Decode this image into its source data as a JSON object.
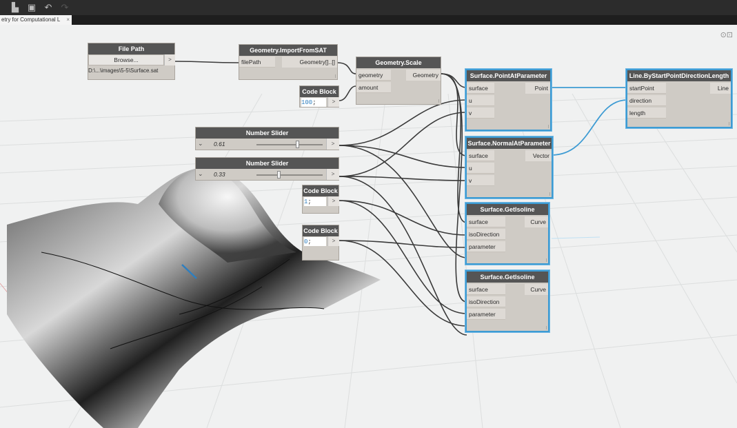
{
  "tab": {
    "title": "etry for Computational L",
    "close": "×"
  },
  "toolbar": {
    "icons": [
      "new-file-icon",
      "save-icon",
      "undo-icon",
      "redo-icon"
    ]
  },
  "canvas": {
    "zoom_icon": "fit-view-icon",
    "zoom_label": "⊙⊡"
  },
  "nodes": {
    "file_path": {
      "title": "File Path",
      "button": "Browse...",
      "out": ">",
      "path": "D:\\...\\images\\5-5\\Surface.sat"
    },
    "import_sat": {
      "title": "Geometry.ImportFromSAT",
      "in": [
        "filePath"
      ],
      "out": [
        "Geometry[]..[]"
      ]
    },
    "scale": {
      "title": "Geometry.Scale",
      "in": [
        "geometry",
        "amount"
      ],
      "out": [
        "Geometry"
      ]
    },
    "code1": {
      "title": "Code Block",
      "value": "100",
      "rest": ";",
      "out": ">"
    },
    "slider1": {
      "title": "Number Slider",
      "value": "0.61",
      "fraction": 0.61,
      "out": ">",
      "expander": "⌄"
    },
    "slider2": {
      "title": "Number Slider",
      "value": "0.33",
      "fraction": 0.33,
      "out": ">",
      "expander": "⌄"
    },
    "code2": {
      "title": "Code Block",
      "value": "1",
      "rest": ";",
      "out": ">"
    },
    "code3": {
      "title": "Code Block",
      "value": "0",
      "rest": ";",
      "out": ">"
    },
    "point_at": {
      "title": "Surface.PointAtParameter",
      "in": [
        "surface",
        "u",
        "v"
      ],
      "out": [
        "Point"
      ]
    },
    "normal_at": {
      "title": "Surface.NormalAtParameter",
      "in": [
        "surface",
        "u",
        "v"
      ],
      "out": [
        "Vector"
      ]
    },
    "isoline1": {
      "title": "Surface.GetIsoline",
      "in": [
        "surface",
        "isoDirection",
        "parameter"
      ],
      "out": [
        "Curve"
      ]
    },
    "isoline2": {
      "title": "Surface.GetIsoline",
      "in": [
        "surface",
        "isoDirection",
        "parameter"
      ],
      "out": [
        "Curve"
      ]
    },
    "line_node": {
      "title": "Line.ByStartPointDirectionLength",
      "in": [
        "startPoint",
        "direction",
        "length"
      ],
      "out": [
        "Line"
      ]
    }
  },
  "colors": {
    "wire": "#3a3a3a",
    "selected_wire": "#3d9bd3",
    "node_header": "#555555",
    "node_body": "#cfcbc5"
  }
}
